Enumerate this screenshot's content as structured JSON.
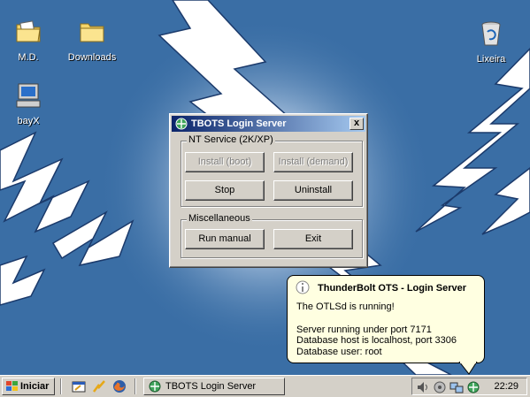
{
  "desktop": {
    "icons": [
      {
        "label": "M.D.",
        "icon": "my-documents-folder-icon"
      },
      {
        "label": "Downloads",
        "icon": "folder-icon"
      },
      {
        "label": "Lixeira",
        "icon": "recycle-bin-icon"
      },
      {
        "label": "bayX",
        "icon": "my-computer-icon"
      }
    ]
  },
  "dialog": {
    "title": "TBOTS Login Server",
    "close_label": "x",
    "nt_group": {
      "legend": "NT Service (2K/XP)",
      "buttons": [
        "Install (boot)",
        "Install (demand)",
        "Stop",
        "Uninstall"
      ]
    },
    "misc_group": {
      "legend": "Miscellaneous",
      "buttons": [
        "Run manual",
        "Exit"
      ]
    }
  },
  "balloon": {
    "title": "ThunderBolt OTS - Login Server",
    "lines": [
      "The OTLSd is running!",
      "Server running under port 7171",
      "Database host is localhost, port 3306",
      "Database user: root"
    ]
  },
  "taskbar": {
    "start_label": "Iniciar",
    "task_label": "TBOTS Login Server",
    "clock": "22:29",
    "quicklaunch": [
      "show-desktop-icon",
      "winamp-icon",
      "firefox-icon"
    ],
    "tray": [
      "volume-icon",
      "tray-app-icon",
      "network-icon",
      "tbots-tray-icon"
    ]
  },
  "colors": {
    "desktop": "#3a6ea5",
    "titlebar": "#0a246a",
    "balloon": "#ffffe1"
  }
}
